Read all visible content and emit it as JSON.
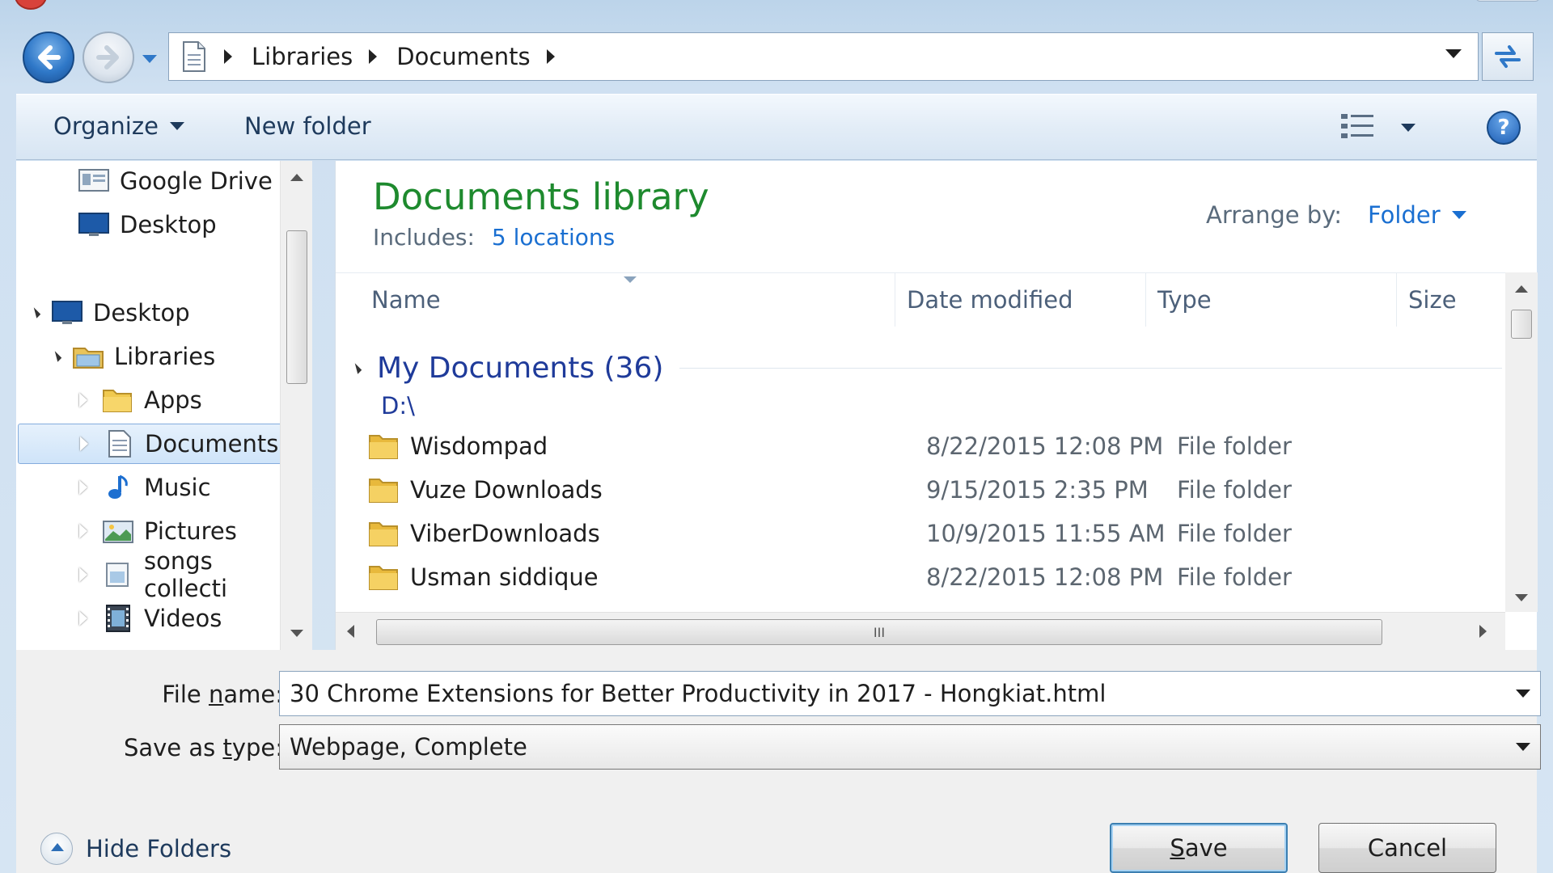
{
  "address": {
    "crumbs": [
      "Libraries",
      "Documents"
    ]
  },
  "toolbar": {
    "organize": "Organize",
    "new_folder": "New folder",
    "help": "?"
  },
  "nav_pane": {
    "items": [
      {
        "label": "Google Drive",
        "icon": "google-drive-icon"
      },
      {
        "label": "Desktop",
        "icon": "desktop-icon"
      },
      {
        "label": "Desktop",
        "icon": "desktop-icon"
      },
      {
        "label": "Libraries",
        "icon": "libraries-icon"
      },
      {
        "label": "Apps",
        "icon": "folder-icon"
      },
      {
        "label": "Documents",
        "icon": "documents-icon"
      },
      {
        "label": "Music",
        "icon": "music-icon"
      },
      {
        "label": "Pictures",
        "icon": "pictures-icon"
      },
      {
        "label": "songs collecti",
        "icon": "library-icon"
      },
      {
        "label": "Videos",
        "icon": "videos-icon"
      }
    ]
  },
  "content": {
    "title": "Documents library",
    "includes_label": "Includes:",
    "includes_link": "5 locations",
    "arrange_label": "Arrange by:",
    "arrange_value": "Folder",
    "columns": [
      "Name",
      "Date modified",
      "Type",
      "Size"
    ],
    "group_name": "My Documents (36)",
    "group_path": "D:\\",
    "rows": [
      {
        "name": "Wisdompad",
        "date": "8/22/2015 12:08 PM",
        "type": "File folder"
      },
      {
        "name": "Vuze Downloads",
        "date": "9/15/2015 2:35 PM",
        "type": "File folder"
      },
      {
        "name": "ViberDownloads",
        "date": "10/9/2015 11:55 AM",
        "type": "File folder"
      },
      {
        "name": "Usman siddique",
        "date": "8/22/2015 12:08 PM",
        "type": "File folder"
      }
    ],
    "scroll_grip": "III"
  },
  "form": {
    "file_name_label_pre": "File ",
    "file_name_label_u": "n",
    "file_name_label_post": "ame:",
    "file_name_value": "30 Chrome Extensions for Better Productivity in 2017 - Hongkiat.html",
    "save_type_label_pre": "Save as ",
    "save_type_label_u": "t",
    "save_type_label_post": "ype:",
    "save_type_value": "Webpage, Complete"
  },
  "footer": {
    "hide_folders": "Hide Folders",
    "save_u": "S",
    "save_rest": "ave",
    "cancel": "Cancel"
  },
  "colors": {
    "title_green": "#1e8a2e",
    "link_blue": "#1a6fd1",
    "group_blue": "#1f3b9a"
  }
}
